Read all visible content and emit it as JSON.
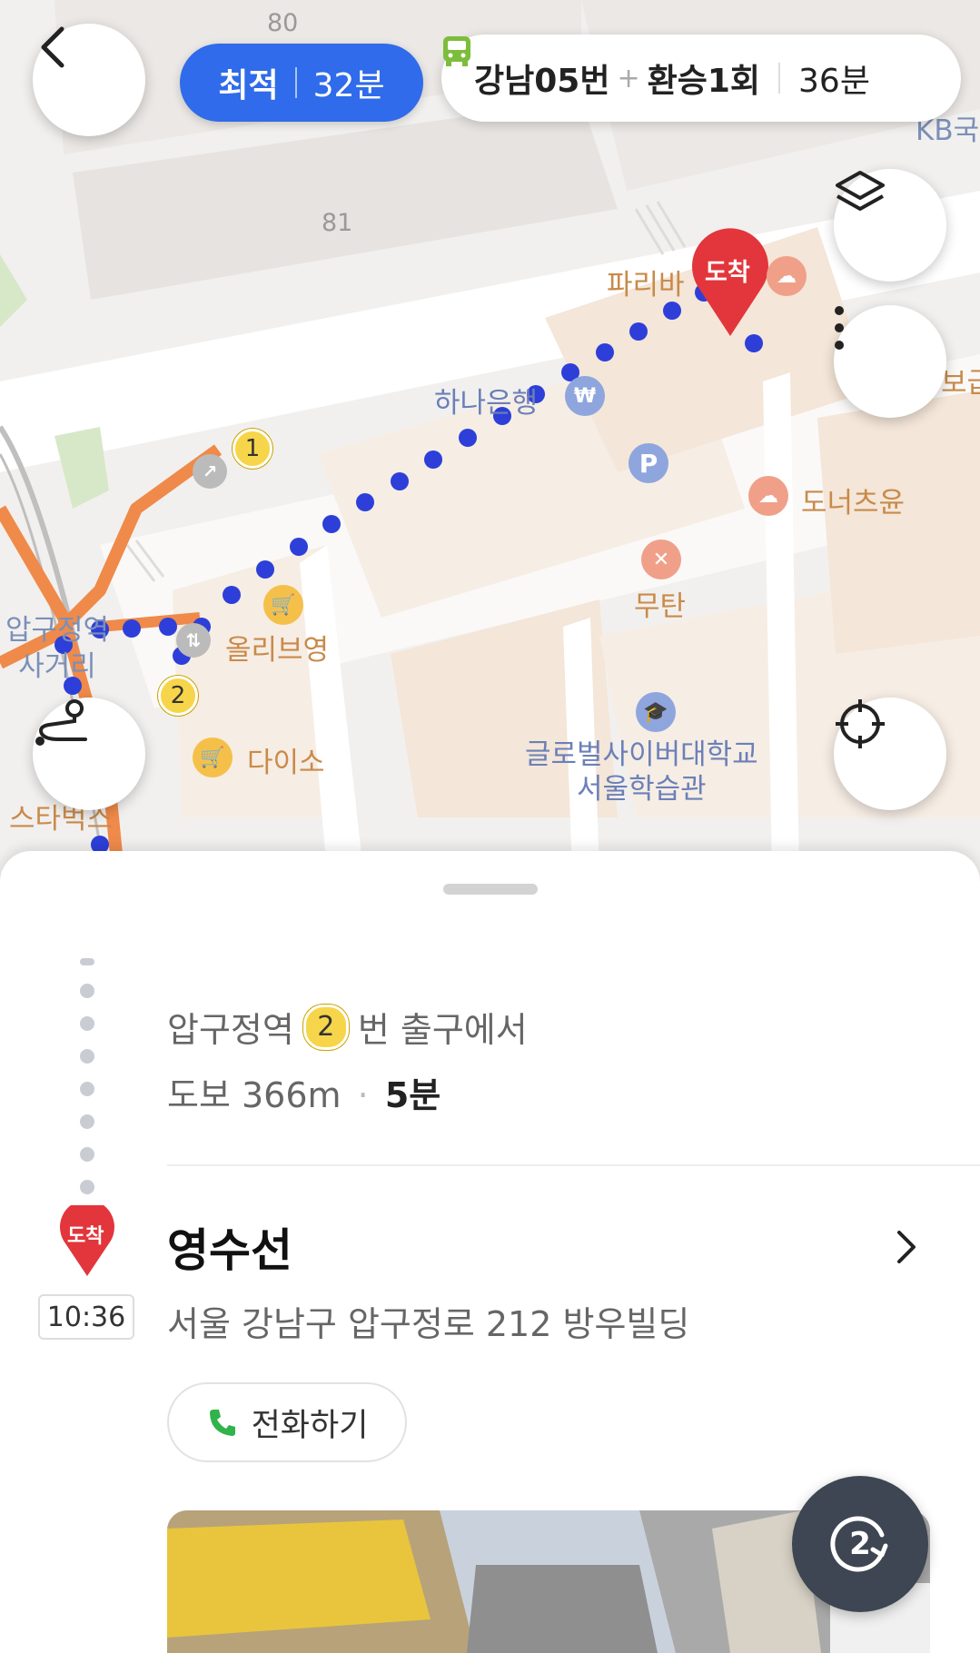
{
  "route_tabs": {
    "primary": {
      "label": "최적",
      "time": "32분"
    },
    "alternate": {
      "bus": "강남05번",
      "plus": "+",
      "transfer": "환승1회",
      "time": "36분"
    }
  },
  "map": {
    "block_numbers": [
      "80",
      "81"
    ],
    "destination_marker": "도착",
    "partial_label_right": "KB국",
    "partial_label_right2": "보급",
    "station_name": "압구정역\n사거리",
    "exits": [
      "1",
      "2"
    ],
    "places": [
      {
        "name": "파리바",
        "icon": "cloud-cafe-icon"
      },
      {
        "name": "하나은행",
        "icon": "won-bank-icon"
      },
      {
        "name": "도너츠윤",
        "icon": "cloud-cafe-icon"
      },
      {
        "name": "무탄",
        "icon": "restaurant-icon"
      },
      {
        "name": "올리브영",
        "icon": "shopping-cart-icon"
      },
      {
        "name": "다이소",
        "icon": "shopping-cart-icon"
      },
      {
        "name": "글로벌사이버대학교\n서울학습관",
        "icon": "school-icon"
      },
      {
        "name": "스타벅스",
        "icon": "cafe-icon"
      }
    ],
    "colors": {
      "walk_route": "#2d3fd8",
      "subway_line": "#ef8a4a",
      "marker": "#e2363c",
      "accent": "#2f6bea"
    }
  },
  "buttons": {
    "back_icon": "chevron-left-icon",
    "layers_icon": "layers-icon",
    "more_icon": "more-vertical-icon",
    "route_icon": "route-icon",
    "locate_icon": "crosshair-icon"
  },
  "sheet": {
    "walk": {
      "from_prefix": "압구정역",
      "exit_number": "2",
      "from_suffix": "번 출구에서",
      "walk_label": "도보 366m",
      "dot": "·",
      "duration": "5분"
    },
    "arrival": {
      "marker": "도착",
      "time": "10:36",
      "name": "영수선",
      "address": "서울 강남구 압구정로 212 방우빌딩",
      "call_label": "전화하기"
    },
    "refresh_count": "2"
  }
}
